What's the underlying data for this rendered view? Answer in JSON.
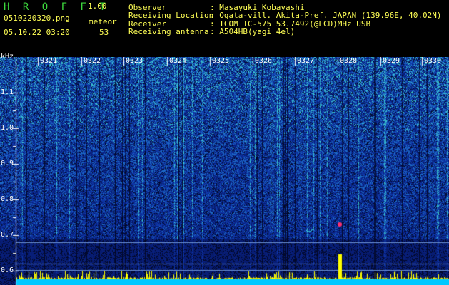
{
  "header": {
    "app_title": "H R O F F T",
    "app_version": "1.00",
    "filename": "0510220320.png",
    "datetime": "05.10.22 03:20",
    "meteor_label": "meteor",
    "meteor_count": "53",
    "info": [
      {
        "label": "Observer",
        "value": ": Masayuki Kobayashi"
      },
      {
        "label": "Receiving Location",
        "value": ": Ogata-vill. Akita-Pref. JAPAN (139.96E, 40.02N)"
      },
      {
        "label": "Receiver",
        "value": ": ICOM IC-575 53.7492(@LCD)MHz USB"
      },
      {
        "label": "Receiving antenna",
        "value": ": A504HB(yagi 4el)"
      }
    ]
  },
  "axis": {
    "unit": "kHz",
    "y_ticks": [
      "1.1",
      "1.0",
      "0.9",
      "0.8",
      "0.7",
      "0.6"
    ],
    "x_ticks": [
      "0321",
      "0322",
      "0323",
      "0324",
      "0325",
      "0326",
      "0327",
      "0328",
      "0329",
      "0330"
    ]
  },
  "colors": {
    "background": "#000000",
    "header_green": "#3cd63c",
    "header_yellow": "#ffff55",
    "spectrogram_low": "#0b1f7a",
    "spectrogram_high": "#3fd0d0",
    "signal_level": "#ffff00",
    "noise_floor": "#00c8ff"
  }
}
